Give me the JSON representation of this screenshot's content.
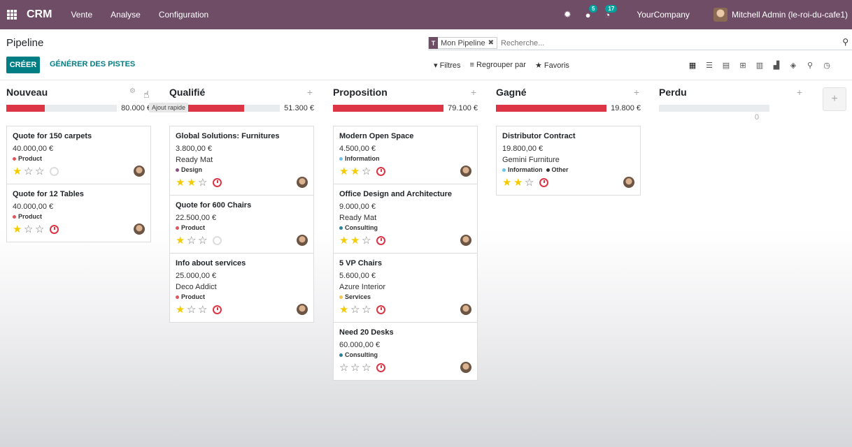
{
  "navbar": {
    "brand": "CRM",
    "menus": [
      "Vente",
      "Analyse",
      "Configuration"
    ],
    "messages_count": "5",
    "activities_count": "17",
    "company": "YourCompany",
    "user": "Mitchell Admin (le-roi-du-cafe1)"
  },
  "control": {
    "breadcrumb": "Pipeline",
    "facet": "Mon Pipeline",
    "search_placeholder": "Recherche...",
    "create_label": "CRÉER",
    "generate_label": "GÉNÉRER DES PISTES",
    "filters_label": "Filtres",
    "groupby_label": "Regrouper par",
    "favorites_label": "Favoris"
  },
  "tooltip": "Ajout rapide",
  "columns": [
    {
      "title": "Nouveau",
      "total": "80.000 €",
      "progress": 0.35,
      "cards": [
        {
          "title": "Quote for 150 carpets",
          "amount": "40.000,00 €",
          "customer": "",
          "tags": [
            {
              "label": "Product",
              "color": "#e0565c"
            }
          ],
          "stars": 1,
          "activity": "none"
        },
        {
          "title": "Quote for 12 Tables",
          "amount": "40.000,00 €",
          "customer": "",
          "tags": [
            {
              "label": "Product",
              "color": "#e0565c"
            }
          ],
          "stars": 1,
          "activity": "late"
        }
      ]
    },
    {
      "title": "Qualifié",
      "total": "51.300 €",
      "progress": 0.68,
      "cards": [
        {
          "title": "Global Solutions: Furnitures",
          "amount": "3.800,00 €",
          "customer": "Ready Mat",
          "tags": [
            {
              "label": "Design",
              "color": "#8a4f7d"
            }
          ],
          "stars": 2,
          "activity": "late"
        },
        {
          "title": "Quote for 600 Chairs",
          "amount": "22.500,00 €",
          "customer": "",
          "tags": [
            {
              "label": "Product",
              "color": "#e0565c"
            }
          ],
          "stars": 1,
          "activity": "none"
        },
        {
          "title": "Info about services",
          "amount": "25.000,00 €",
          "customer": "Deco Addict",
          "tags": [
            {
              "label": "Product",
              "color": "#e0565c"
            }
          ],
          "stars": 1,
          "activity": "late"
        }
      ]
    },
    {
      "title": "Proposition",
      "total": "79.100 €",
      "progress": 1.0,
      "cards": [
        {
          "title": "Modern Open Space",
          "amount": "4.500,00 €",
          "customer": "",
          "tags": [
            {
              "label": "Information",
              "color": "#6cc1ed"
            }
          ],
          "stars": 2,
          "activity": "late"
        },
        {
          "title": "Office Design and Architecture",
          "amount": "9.000,00 €",
          "customer": "Ready Mat",
          "tags": [
            {
              "label": "Consulting",
              "color": "#2c8397"
            }
          ],
          "stars": 2,
          "activity": "late"
        },
        {
          "title": "5 VP Chairs",
          "amount": "5.600,00 €",
          "customer": "Azure Interior",
          "tags": [
            {
              "label": "Services",
              "color": "#f3c64f"
            }
          ],
          "stars": 1,
          "activity": "late"
        },
        {
          "title": "Need 20 Desks",
          "amount": "60.000,00 €",
          "customer": "",
          "tags": [
            {
              "label": "Consulting",
              "color": "#2c8397"
            }
          ],
          "stars": 0,
          "activity": "late"
        }
      ]
    },
    {
      "title": "Gagné",
      "total": "19.800 €",
      "progress": 1.0,
      "cards": [
        {
          "title": "Distributor Contract",
          "amount": "19.800,00 €",
          "customer": "Gemini Furniture",
          "tags": [
            {
              "label": "Information",
              "color": "#6cc1ed"
            },
            {
              "label": "Other",
              "color": "#333333"
            }
          ],
          "stars": 2,
          "activity": "late"
        }
      ]
    },
    {
      "title": "Perdu",
      "total": "0",
      "progress": 0,
      "cards": []
    }
  ]
}
